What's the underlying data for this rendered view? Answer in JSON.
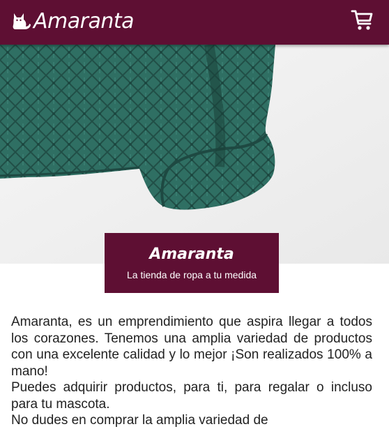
{
  "header": {
    "brand_name": "Amaranta",
    "logo_icon": "cat-icon",
    "cart_icon": "shopping-cart-icon"
  },
  "hero": {
    "image": "green-knit-sweater-photo"
  },
  "banner": {
    "title": "Amaranta",
    "subtitle": "La tienda de ropa a tu medida"
  },
  "content": {
    "paragraphs": [
      "Amaranta, es un emprendimiento que aspira llegar a todos los corazones. Tenemos una amplia variedad de productos con una excelente calidad y lo mejor ¡Son realizados 100% a mano!",
      "Puedes adquirir productos, para ti, para regalar o incluso para tu mascota.",
      "No dudes en comprar la amplia variedad de"
    ]
  },
  "colors": {
    "brand": "#5e0f33",
    "sweater": "#2f6f63",
    "background": "#f1f1f1"
  }
}
